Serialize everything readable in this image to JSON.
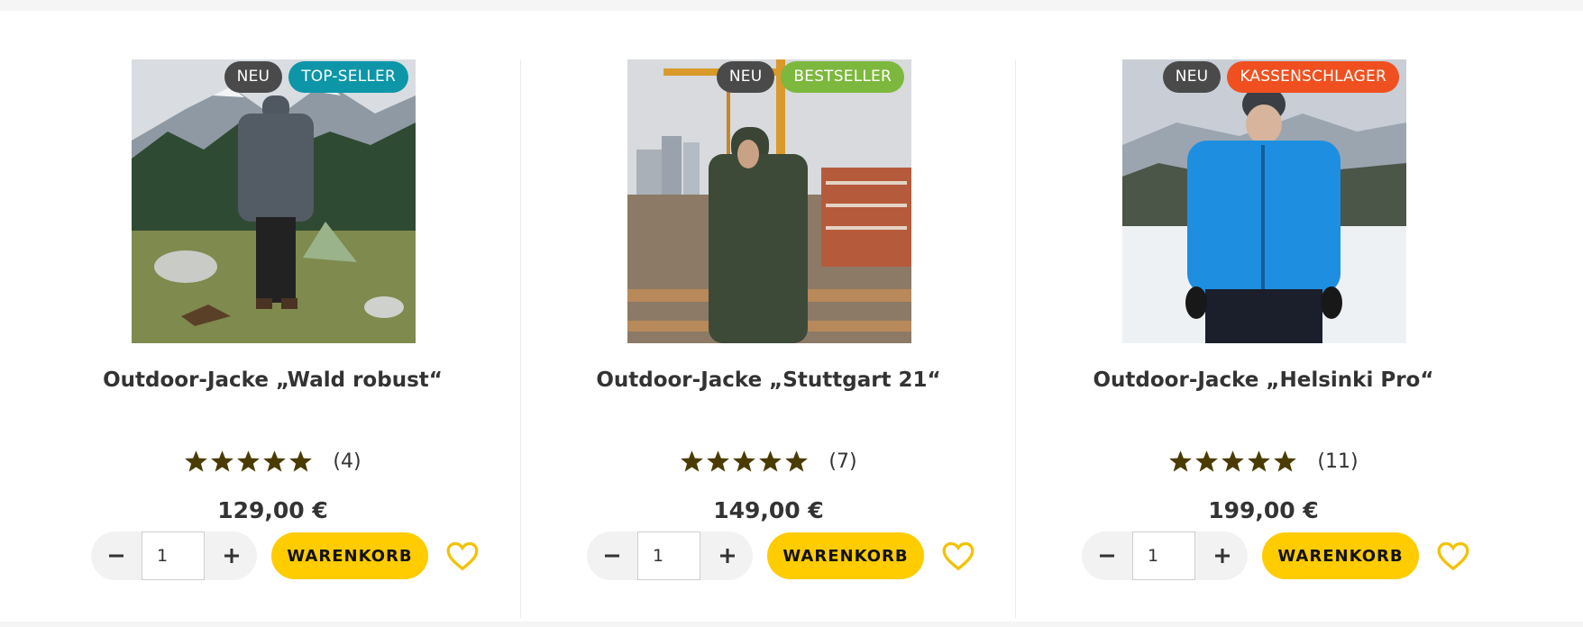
{
  "colors": {
    "badge_new": "#4a4a4a",
    "badge_top_seller": "#0d96a8",
    "badge_bestseller": "#7cb83d",
    "badge_kassenschlager": "#f05020",
    "star": "#4a3c00",
    "cart_button": "#ffcc00",
    "wishlist_heart": "#f2c200"
  },
  "icons": {
    "star": "star-icon",
    "minus": "minus-icon",
    "plus": "plus-icon",
    "wishlist": "heart-outline-icon"
  },
  "cart_label": "WARENKORB",
  "products": [
    {
      "title": "Outdoor-Jacke „Wald robust“",
      "badges": [
        {
          "label": "NEU",
          "color": "#4a4a4a"
        },
        {
          "label": "TOP-SELLER",
          "color": "#0d96a8"
        }
      ],
      "rating": 5,
      "review_count": "(4)",
      "price": "129,00 €",
      "quantity": "1",
      "image": "Man in grey jacket standing in mountain meadow with tent"
    },
    {
      "title": "Outdoor-Jacke „Stuttgart 21“",
      "badges": [
        {
          "label": "NEU",
          "color": "#4a4a4a"
        },
        {
          "label": "BESTSELLER",
          "color": "#7cb83d"
        }
      ],
      "rating": 5,
      "review_count": "(7)",
      "price": "149,00 €",
      "quantity": "1",
      "image": "Man in dark green hooded jacket in front of construction site with cranes"
    },
    {
      "title": "Outdoor-Jacke „Helsinki Pro“",
      "badges": [
        {
          "label": "NEU",
          "color": "#4a4a4a"
        },
        {
          "label": "KASSENSCHLAGER",
          "color": "#f05020"
        }
      ],
      "rating": 5,
      "review_count": "(11)",
      "price": "199,00 €",
      "quantity": "1",
      "image": "Man in bright blue ski jacket and beanie in snowy landscape"
    }
  ]
}
